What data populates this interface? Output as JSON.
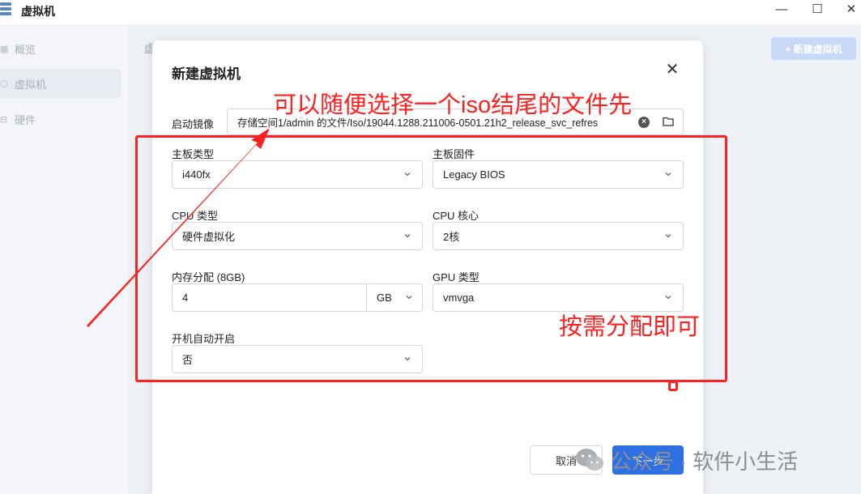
{
  "window": {
    "title": "虚拟机",
    "minimize": "—",
    "maximize": "☐",
    "close": "✕"
  },
  "sidebar": {
    "items": [
      {
        "label": "概览",
        "icon": "grid-icon",
        "glyph": "▦"
      },
      {
        "label": "虚拟机",
        "icon": "cube-icon",
        "glyph": "⬡"
      },
      {
        "label": "硬件",
        "icon": "drive-icon",
        "glyph": "⊟"
      }
    ],
    "active_index": 1
  },
  "main": {
    "header_letter": "虚",
    "new_vm_button": "+ 新建虚拟机"
  },
  "dialog": {
    "title": "新建虚拟机",
    "close": "✕",
    "boot_image": {
      "label": "启动镜像",
      "value": "存储空间1/admin 的文件/Iso/19044.1288.211006-0501.21h2_release_svc_refres"
    },
    "board_type": {
      "label": "主板类型",
      "value": "i440fx"
    },
    "board_firmware": {
      "label": "主板固件",
      "value": "Legacy BIOS"
    },
    "cpu_type": {
      "label": "CPU 类型",
      "value": "硬件虚拟化"
    },
    "cpu_cores": {
      "label": "CPU 核心",
      "value": "2核"
    },
    "memory": {
      "label": "内存分配 (8GB)",
      "value": "4",
      "unit": "GB"
    },
    "gpu_type": {
      "label": "GPU 类型",
      "value": "vmvga"
    },
    "autostart": {
      "label": "开机自动开启",
      "value": "否"
    },
    "cancel_button": "取消",
    "next_button": "下一步"
  },
  "annotations": {
    "text1": "可以随便选择一个iso结尾的文件先",
    "text2": "按需分配即可",
    "color": "#ff2020"
  },
  "watermark": {
    "text": "公众号 · 软件小生活"
  },
  "colors": {
    "primary": "#2f6fe4",
    "new_vm_button_bg": "#c7d9f7"
  }
}
